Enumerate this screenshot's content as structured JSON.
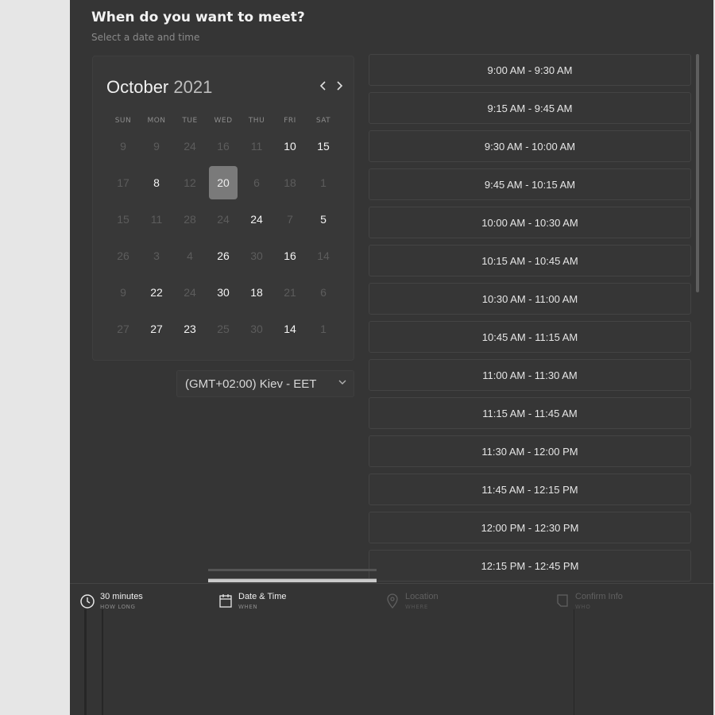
{
  "header": {
    "title": "When do you want to meet?",
    "subtitle": "Select a date and time"
  },
  "calendar": {
    "month": "October",
    "year": "2021",
    "weekdays": [
      "SUN",
      "MON",
      "TUE",
      "WED",
      "THU",
      "FRI",
      "SAT"
    ],
    "weeks": [
      [
        {
          "d": "9",
          "a": false
        },
        {
          "d": "9",
          "a": false
        },
        {
          "d": "24",
          "a": false
        },
        {
          "d": "16",
          "a": false
        },
        {
          "d": "11",
          "a": false
        },
        {
          "d": "10",
          "a": true
        },
        {
          "d": "15",
          "a": true
        }
      ],
      [
        {
          "d": "17",
          "a": false
        },
        {
          "d": "8",
          "a": true
        },
        {
          "d": "12",
          "a": false
        },
        {
          "d": "20",
          "a": true,
          "sel": true
        },
        {
          "d": "6",
          "a": false
        },
        {
          "d": "18",
          "a": false
        },
        {
          "d": "1",
          "a": false
        }
      ],
      [
        {
          "d": "15",
          "a": false
        },
        {
          "d": "11",
          "a": false
        },
        {
          "d": "28",
          "a": false
        },
        {
          "d": "24",
          "a": false
        },
        {
          "d": "24",
          "a": true
        },
        {
          "d": "7",
          "a": false
        },
        {
          "d": "5",
          "a": true
        }
      ],
      [
        {
          "d": "26",
          "a": false
        },
        {
          "d": "3",
          "a": false
        },
        {
          "d": "4",
          "a": false
        },
        {
          "d": "26",
          "a": true
        },
        {
          "d": "30",
          "a": false
        },
        {
          "d": "16",
          "a": true
        },
        {
          "d": "14",
          "a": false
        }
      ],
      [
        {
          "d": "9",
          "a": false
        },
        {
          "d": "22",
          "a": true
        },
        {
          "d": "24",
          "a": false
        },
        {
          "d": "30",
          "a": true
        },
        {
          "d": "18",
          "a": true
        },
        {
          "d": "21",
          "a": false
        },
        {
          "d": "6",
          "a": false
        }
      ],
      [
        {
          "d": "27",
          "a": false
        },
        {
          "d": "27",
          "a": true
        },
        {
          "d": "23",
          "a": true
        },
        {
          "d": "25",
          "a": false
        },
        {
          "d": "30",
          "a": false
        },
        {
          "d": "14",
          "a": true
        },
        {
          "d": "1",
          "a": false
        }
      ]
    ],
    "prev_icon": "chevron-left-icon",
    "next_icon": "chevron-right-icon"
  },
  "timezone": {
    "label": "(GMT+02:00) Kiev - EET",
    "icon": "chevron-down-icon"
  },
  "time_slots": [
    "9:00 AM - 9:30 AM",
    "9:15 AM - 9:45 AM",
    "9:30 AM - 10:00 AM",
    "9:45 AM - 10:15 AM",
    "10:00 AM - 10:30 AM",
    "10:15 AM - 10:45 AM",
    "10:30 AM - 11:00 AM",
    "10:45 AM - 11:15 AM",
    "11:00 AM - 11:30 AM",
    "11:15 AM - 11:45 AM",
    "11:30 AM - 12:00 PM",
    "11:45 AM - 12:15 PM",
    "12:00 PM - 12:30 PM",
    "12:15 PM - 12:45 PM"
  ],
  "steps": [
    {
      "name": "30 minutes",
      "sub": "HOW LONG",
      "icon": "clock-icon"
    },
    {
      "name": "Date & Time",
      "sub": "WHEN",
      "icon": "calendar-icon"
    },
    {
      "name": "Location",
      "sub": "WHERE",
      "icon": "location-pin-icon"
    },
    {
      "name": "Confirm Info",
      "sub": "WHO",
      "icon": "document-icon"
    }
  ],
  "colors": {
    "panel_bg": "#353535",
    "page_bg": "#e6e6e6",
    "selected_day": "#7a7a7a"
  }
}
